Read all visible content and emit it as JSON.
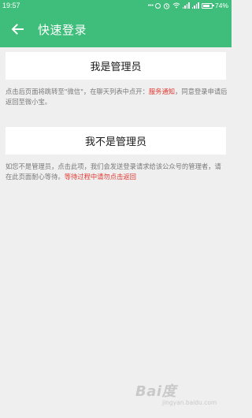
{
  "status_bar": {
    "time": "19:57",
    "icons": [
      "dots-icon",
      "ring-icon",
      "alarm-icon",
      "wifi-icon",
      "signal-icon",
      "signal-icon",
      "battery-icon"
    ],
    "battery_percent": "74%"
  },
  "header": {
    "title": "快速登录",
    "back_icon": "arrow-left-icon"
  },
  "options": [
    {
      "label": "我是管理员",
      "description": "点击后页面将跳转至\"微信\"，在聊天列表中点开：",
      "highlight": "服务通知",
      "description_tail": "同意登录申请后返回至微小宝。"
    },
    {
      "label": "我不是管理员",
      "description": "如您不是管理员，点击此项，我们会发送登录请求给该公众号的管理者，请在此页面耐心等待。",
      "highlight": "等待过程中请勿点击返回"
    }
  ],
  "watermark": {
    "logo": "Bai度",
    "sub": "jingyan.baidu.com"
  },
  "colors": {
    "accent": "#3fbd7a",
    "background": "#efefef",
    "highlight": "#e23b34",
    "muted_text": "#7a7a7a"
  }
}
